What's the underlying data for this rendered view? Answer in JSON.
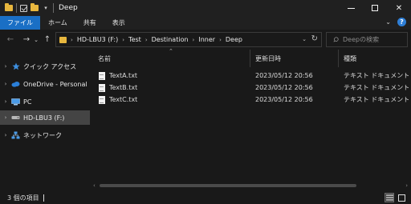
{
  "window": {
    "title": "Deep"
  },
  "ribbon": {
    "tabs": [
      "ファイル",
      "ホーム",
      "共有",
      "表示"
    ]
  },
  "address": {
    "crumbs": [
      "HD-LBU3 (F:)",
      "Test",
      "Destination",
      "Inner",
      "Deep"
    ]
  },
  "search": {
    "placeholder": "Deepの検索"
  },
  "navpane": {
    "items": [
      {
        "label": "クイック アクセス",
        "icon": "star-icon",
        "selected": false
      },
      {
        "label": "OneDrive - Personal",
        "icon": "cloud-icon",
        "selected": false
      },
      {
        "label": "PC",
        "icon": "pc-icon",
        "selected": false
      },
      {
        "label": "HD-LBU3 (F:)",
        "icon": "drive-icon",
        "selected": true
      },
      {
        "label": "ネットワーク",
        "icon": "network-icon",
        "selected": false
      }
    ]
  },
  "columns": {
    "name": "名前",
    "date": "更新日時",
    "type": "種類"
  },
  "files": [
    {
      "name": "TextA.txt",
      "date": "2023/05/12 20:56",
      "type": "テキスト ドキュメント"
    },
    {
      "name": "TextB.txt",
      "date": "2023/05/12 20:56",
      "type": "テキスト ドキュメント"
    },
    {
      "name": "TextC.txt",
      "date": "2023/05/12 20:56",
      "type": "テキスト ドキュメント"
    }
  ],
  "status": {
    "text": "3 個の項目"
  },
  "colors": {
    "accent": "#1a6fc5",
    "folder": "#e8b73e",
    "background": "#191919",
    "selected": "#444444"
  }
}
